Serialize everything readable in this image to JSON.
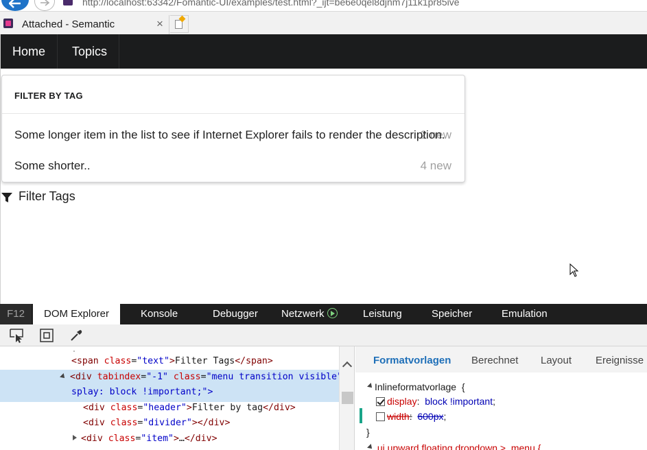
{
  "browser": {
    "url": "http://localhost:63342/Fomantic-UI/examples/test.html?_ijt=be6e0qel8djnm7j11k1pr85ive",
    "tab_title": "Attached - Semantic",
    "tab_close": "×"
  },
  "page": {
    "menu": {
      "items": [
        {
          "label": "Home"
        },
        {
          "label": "Topics"
        }
      ]
    },
    "dropdown": {
      "header": "FILTER BY TAG",
      "items": [
        {
          "text": "Some longer item in the list to see if Internet Explorer fails to render the description.",
          "description": "2 new"
        },
        {
          "text": "Some shorter..",
          "description": "4 new"
        }
      ]
    },
    "filter_label": "Filter Tags"
  },
  "devtools": {
    "tabs": [
      {
        "label": "F12"
      },
      {
        "label": "DOM Explorer"
      },
      {
        "label": "Konsole"
      },
      {
        "label": "Debugger"
      },
      {
        "label": "Netzwerk"
      },
      {
        "label": "Leistung"
      },
      {
        "label": "Speicher"
      },
      {
        "label": "Emulation"
      }
    ],
    "dom": {
      "lines": [
        {
          "tag": "<span ",
          "attr": "class",
          "eq": "=",
          "val": "\"text\"",
          "close": ">",
          "text": "Filter Tags",
          "end": "</span>"
        },
        {
          "open": "<div ",
          "attr1": "tabindex",
          "val1": "\"-1\"",
          "attr2": "class",
          "val2": "\"menu transition visible\""
        },
        {
          "cont": "splay: block !important;\">"
        },
        {
          "tag": "<div ",
          "attr": "class",
          "eq": "=",
          "val": "\"header\"",
          "close": ">",
          "text": "Filter by tag",
          "end": "</div>"
        },
        {
          "tag": "<div ",
          "attr": "class",
          "eq": "=",
          "val": "\"divider\"",
          "close": ">",
          "text": "",
          "end": "</div>"
        },
        {
          "tag": "<div ",
          "attr": "class",
          "eq": "=",
          "val": "\"item\"",
          "close": ">",
          "text": "…",
          "end": "</div>"
        }
      ]
    },
    "styles": {
      "tabs": [
        {
          "label": "Formatvorlagen"
        },
        {
          "label": "Berechnet"
        },
        {
          "label": "Layout"
        },
        {
          "label": "Ereignisse"
        }
      ],
      "rule_selector": "Inlineformatvorlage",
      "open_brace": "{",
      "close_brace": "}",
      "props": [
        {
          "name": "display",
          "value": "block !important",
          "checked": true
        },
        {
          "name": "width",
          "value": "600px",
          "checked": false
        }
      ],
      "next_rule": ".ui.upward.floating.dropdown > .menu {"
    }
  },
  "colors": {
    "menu_bg": "#1b1c1d",
    "devtools_tabbar_bg": "#1e1e1e",
    "selection_bg": "#cde3f5",
    "active_style_tab": "#1e6fb8"
  }
}
